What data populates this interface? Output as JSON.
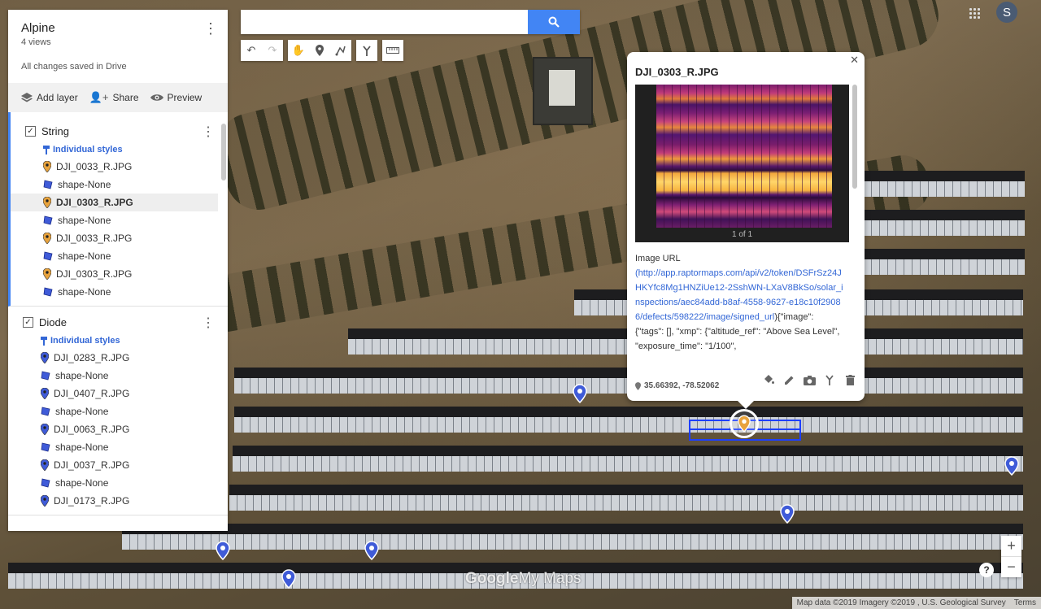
{
  "map": {
    "watermark_google": "Google",
    "watermark_mymaps": "My Maps",
    "attribution": "Map data ©2019 Imagery ©2019 , U.S. Geological Survey",
    "terms": "Terms"
  },
  "panel": {
    "title": "Alpine",
    "views": "4 views",
    "saved": "All changes saved in Drive",
    "toolbar": {
      "add_layer": "Add layer",
      "share": "Share",
      "preview": "Preview"
    },
    "layers": [
      {
        "name": "String",
        "styles": "Individual styles",
        "items": [
          {
            "label": "DJI_0033_R.JPG",
            "type": "pin",
            "color": "#e8a33d"
          },
          {
            "label": "shape-None",
            "type": "shape",
            "color": "#3f5bd8"
          },
          {
            "label": "DJI_0303_R.JPG",
            "type": "pin",
            "color": "#e8a33d"
          },
          {
            "label": "shape-None",
            "type": "shape",
            "color": "#3f5bd8"
          },
          {
            "label": "DJI_0033_R.JPG",
            "type": "pin",
            "color": "#e8a33d"
          },
          {
            "label": "shape-None",
            "type": "shape",
            "color": "#3f5bd8"
          },
          {
            "label": "DJI_0303_R.JPG",
            "type": "pin",
            "color": "#e8a33d"
          },
          {
            "label": "shape-None",
            "type": "shape",
            "color": "#3f5bd8"
          }
        ]
      },
      {
        "name": "Diode",
        "styles": "Individual styles",
        "items": [
          {
            "label": "DJI_0283_R.JPG",
            "type": "pin",
            "color": "#3f5bd8"
          },
          {
            "label": "shape-None",
            "type": "shape",
            "color": "#3f5bd8"
          },
          {
            "label": "DJI_0407_R.JPG",
            "type": "pin",
            "color": "#3f5bd8"
          },
          {
            "label": "shape-None",
            "type": "shape",
            "color": "#3f5bd8"
          },
          {
            "label": "DJI_0063_R.JPG",
            "type": "pin",
            "color": "#3f5bd8"
          },
          {
            "label": "shape-None",
            "type": "shape",
            "color": "#3f5bd8"
          },
          {
            "label": "DJI_0037_R.JPG",
            "type": "pin",
            "color": "#3f5bd8"
          },
          {
            "label": "shape-None",
            "type": "shape",
            "color": "#3f5bd8"
          },
          {
            "label": "DJI_0173_R.JPG",
            "type": "pin",
            "color": "#3f5bd8"
          }
        ]
      }
    ]
  },
  "search": {
    "value": "",
    "placeholder": ""
  },
  "avatar": {
    "initial": "S"
  },
  "popup": {
    "title": "DJI_0303_R.JPG",
    "pager": "1 of 1",
    "desc_label": "Image URL",
    "url_open": "(",
    "url": "http://app.raptormaps.com/api/v2/token/DSFrSz24JHKYfc8Mg1HNZiUe12-2SshWN-LXaV8BkSo/solar_inspections/aec84add-b8af-4558-9627-e18c10f29086/defects/598222/image/signed_url",
    "meta_text": "){\"image\": {\"tags\": [], \"xmp\": {\"altitude_ref\": \"Above Sea Level\", \"exposure_time\": \"1/100\",",
    "coords": "35.66392, -78.52062"
  },
  "colors": {
    "accent": "#4285f4",
    "pin_orange": "#e8a33d",
    "pin_blue": "#3f5bd8",
    "selection": "#1e3fff"
  }
}
